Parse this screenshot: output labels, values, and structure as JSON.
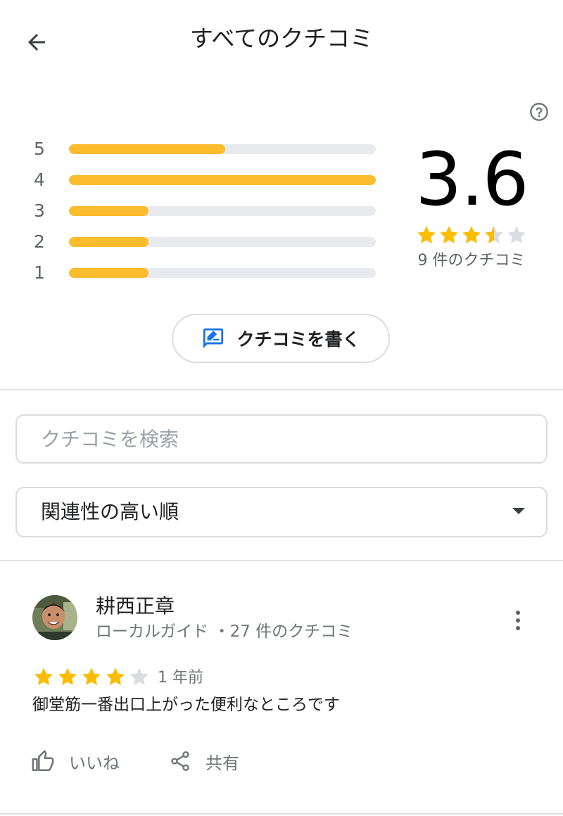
{
  "header": {
    "title": "すべてのクチコミ",
    "back_icon": "arrow-back-icon"
  },
  "help_icon": "help-circle-icon",
  "histogram": [
    {
      "label": "5",
      "fraction": 0.51
    },
    {
      "label": "4",
      "fraction": 1.0
    },
    {
      "label": "3",
      "fraction": 0.26
    },
    {
      "label": "2",
      "fraction": 0.26
    },
    {
      "label": "1",
      "fraction": 0.26
    }
  ],
  "summary": {
    "rating": "3.6",
    "stars": 3.5,
    "review_count": "9 件のクチコミ"
  },
  "write_review": {
    "label": "クチコミを書く",
    "icon": "rate-review-icon"
  },
  "search": {
    "placeholder": "クチコミを検索",
    "value": ""
  },
  "sort": {
    "selected": "関連性の高い順"
  },
  "reviews": [
    {
      "name": "耕西正章",
      "meta": "ローカルガイド ・27 件のクチコミ",
      "stars": 4,
      "time": "1 年前",
      "text": "御堂筋一番出口上がった便利なところです",
      "like_label": "いいね",
      "share_label": "共有"
    }
  ],
  "colors": {
    "star": "#fbbc04",
    "star_empty": "#dadce0",
    "bar_fill": "#fbbc2e",
    "bar_track": "#e8eaed",
    "accent_blue": "#1a73e8"
  }
}
